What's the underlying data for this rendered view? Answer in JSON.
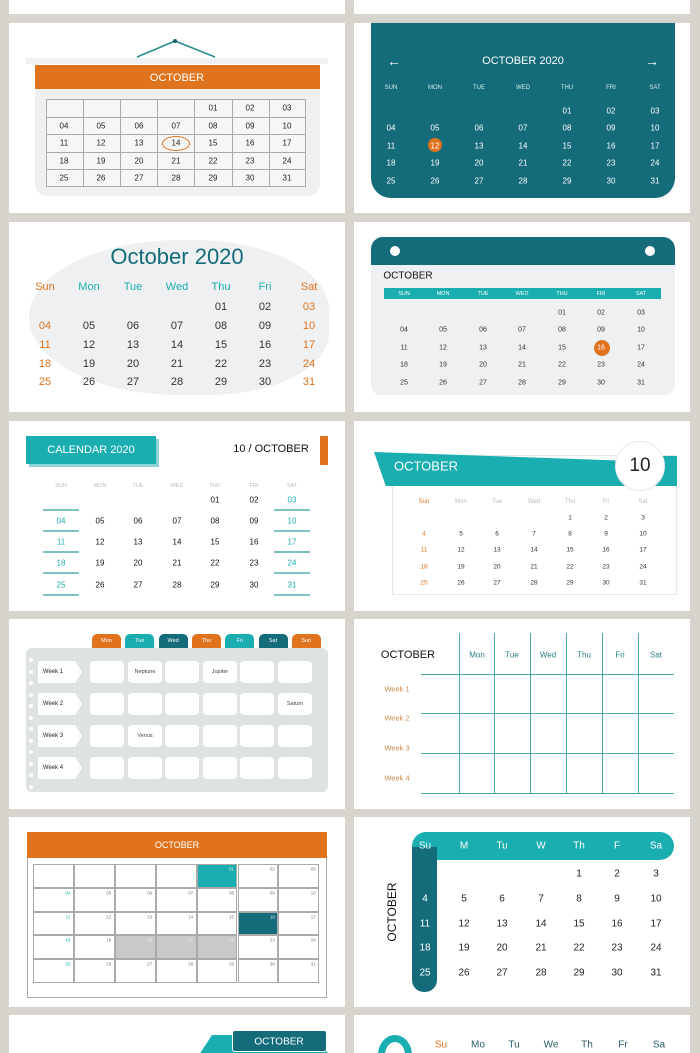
{
  "colors": {
    "teal": "#1aaeb0",
    "dark_teal": "#146b7a",
    "orange": "#e0731e",
    "panel_gray": "#eef0f2",
    "week_label": "#c8894a"
  },
  "weeks_padded": [
    [
      "",
      "",
      "",
      "",
      "01",
      "02",
      "03"
    ],
    [
      "04",
      "05",
      "06",
      "07",
      "08",
      "09",
      "10"
    ],
    [
      "11",
      "12",
      "13",
      "14",
      "15",
      "16",
      "17"
    ],
    [
      "18",
      "19",
      "20",
      "21",
      "22",
      "23",
      "24"
    ],
    [
      "25",
      "26",
      "27",
      "28",
      "29",
      "30",
      "31"
    ]
  ],
  "weeks_plain": [
    [
      "",
      "",
      "",
      "",
      "1",
      "2",
      "3"
    ],
    [
      "4",
      "5",
      "6",
      "7",
      "8",
      "9",
      "10"
    ],
    [
      "11",
      "12",
      "13",
      "14",
      "15",
      "16",
      "17"
    ],
    [
      "18",
      "19",
      "20",
      "21",
      "22",
      "23",
      "24"
    ],
    [
      "25",
      "26",
      "27",
      "28",
      "29",
      "30",
      "31"
    ]
  ],
  "hanging": {
    "title": "OCTOBER",
    "circled_day": "14"
  },
  "teal_card": {
    "title": "OCTOBER 2020",
    "prev_icon": "arrow-left",
    "next_icon": "arrow-right",
    "weekdays": [
      "SUN",
      "MON",
      "TUE",
      "WED",
      "THU",
      "FRI",
      "SAT"
    ],
    "selected_day": "12"
  },
  "blob": {
    "title": "October 2020",
    "weekdays": [
      "Sun",
      "Mon",
      "Tue",
      "Wed",
      "Thu",
      "Fri",
      "Sat"
    ]
  },
  "ring_card": {
    "title": "OCTOBER",
    "weekdays": [
      "SUN",
      "MON",
      "TUE",
      "WED",
      "THU",
      "FRI",
      "SAT"
    ],
    "selected_day": "16"
  },
  "cal2020": {
    "title": "CALENDAR 2020",
    "subtitle": "10 / OCTOBER",
    "weekdays": [
      "SUN",
      "MON",
      "TUE",
      "WED",
      "THU",
      "FRI",
      "SAT"
    ]
  },
  "banner": {
    "title": "OCTOBER",
    "month_number": "10",
    "weekdays": [
      "Sun",
      "Mon",
      "Tue",
      "Wed",
      "Thu",
      "Fri",
      "Sat"
    ]
  },
  "planner": {
    "tabs": [
      "Mon",
      "Tue",
      "Wed",
      "Thu",
      "Fri",
      "Sat",
      "Sun"
    ],
    "weeks": [
      "Week 1",
      "Week 2",
      "Week 3",
      "Week 4"
    ],
    "cells": [
      [
        "",
        "Neptune",
        "",
        "Jupiter",
        "",
        ""
      ],
      [
        "",
        "",
        "",
        "",
        "",
        "Saturn"
      ],
      [
        "",
        "Venus",
        "",
        "",
        "",
        ""
      ],
      [
        "",
        "",
        "",
        "",
        "",
        ""
      ]
    ]
  },
  "week_grid": {
    "title": "OCTOBER",
    "weekdays": [
      "Mon",
      "Tue",
      "Wed",
      "Thu",
      "Fri",
      "Sat"
    ],
    "weeks": [
      "Week 1",
      "Week 2",
      "Week 3",
      "Week 4"
    ]
  },
  "box_grid": {
    "title": "OCTOBER"
  },
  "side_card": {
    "title": "OCTOBER",
    "weekdays": [
      "Su",
      "M",
      "Tu",
      "W",
      "Th",
      "F",
      "Sa"
    ]
  },
  "partial_left": {
    "title": "OCTOBER"
  },
  "partial_right": {
    "weekdays": [
      "Su",
      "Mo",
      "Tu",
      "We",
      "Th",
      "Fr",
      "Sa"
    ]
  }
}
